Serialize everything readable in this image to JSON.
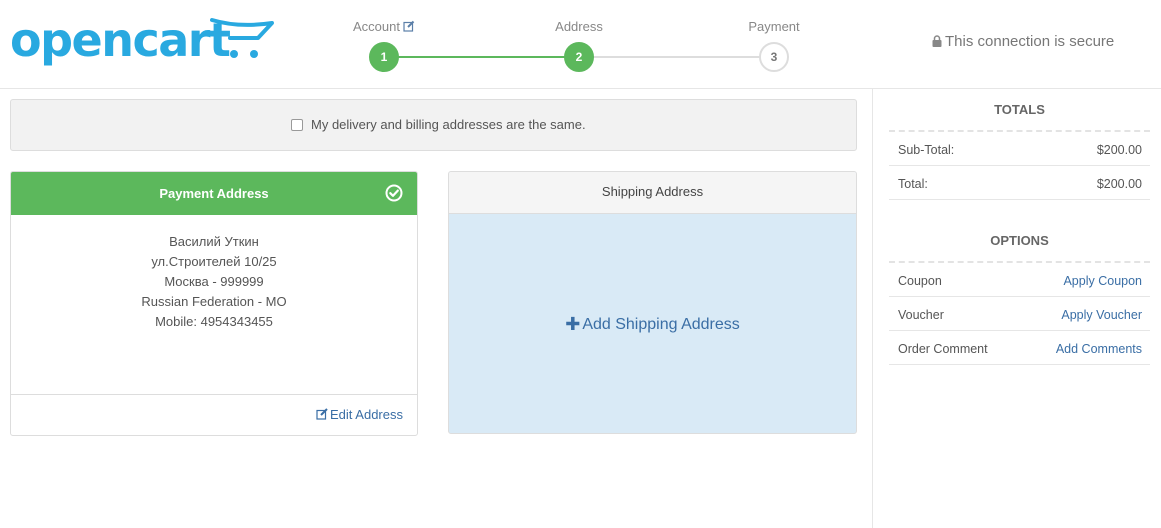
{
  "header": {
    "logo_text": "opencart",
    "steps": [
      {
        "label": "Account",
        "number": "1",
        "state": "done"
      },
      {
        "label": "Address",
        "number": "2",
        "state": "done"
      },
      {
        "label": "Payment",
        "number": "3",
        "state": "todo"
      }
    ],
    "secure_text": "This connection is secure"
  },
  "same_address": {
    "label": "My delivery and billing addresses are the same.",
    "checked": false
  },
  "payment_address": {
    "title": "Payment Address",
    "lines": [
      "Василий Уткин",
      "ул.Строителей 10/25",
      "Москва - 999999",
      "Russian Federation - MO",
      "Mobile: 4954343455"
    ],
    "edit_label": "Edit Address"
  },
  "shipping_address": {
    "title": "Shipping Address",
    "add_label": "Add Shipping Address"
  },
  "totals": {
    "title": "TOTALS",
    "rows": [
      {
        "label": "Sub-Total:",
        "value": "$200.00"
      },
      {
        "label": "Total:",
        "value": "$200.00"
      }
    ]
  },
  "options": {
    "title": "OPTIONS",
    "rows": [
      {
        "label": "Coupon",
        "action": "Apply Coupon"
      },
      {
        "label": "Voucher",
        "action": "Apply Voucher"
      },
      {
        "label": "Order Comment",
        "action": "Add Comments"
      }
    ]
  },
  "colors": {
    "brand": "#29a9e0",
    "success": "#5cb85c",
    "link": "#3a6ea5",
    "shipping_bg": "#d9eaf6"
  }
}
